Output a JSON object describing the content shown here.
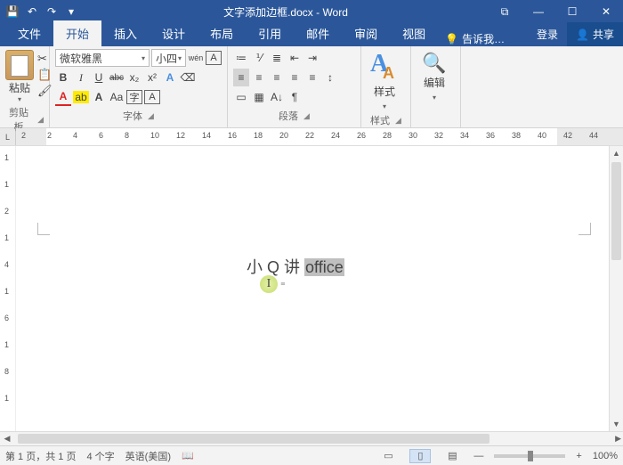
{
  "titlebar": {
    "doc_title": "文字添加边框.docx - Word"
  },
  "window": {
    "snap": "⧉",
    "min": "—",
    "max": "☐",
    "close": "✕"
  },
  "qat": {
    "save": "💾",
    "undo": "↶",
    "redo": "↷",
    "more": "▾"
  },
  "tabs": {
    "file": "文件",
    "home": "开始",
    "insert": "插入",
    "design": "设计",
    "layout": "布局",
    "references": "引用",
    "mail": "邮件",
    "review": "审阅",
    "view": "视图",
    "tell_icon": "💡",
    "tell": "告诉我…",
    "login": "登录",
    "share_icon": "👤",
    "share": "共享"
  },
  "clipboard": {
    "label": "剪贴板",
    "paste": "粘贴",
    "cut": "✂",
    "copy": "📋",
    "painter": "🖌"
  },
  "font": {
    "label": "字体",
    "name": "微软雅黑",
    "size": "小四",
    "wen": "wén",
    "inc": "A",
    "dec": "A",
    "char_box": "A",
    "bold": "B",
    "italic": "I",
    "underline": "U",
    "strike": "abc",
    "sub": "x₂",
    "sup": "x²",
    "effects": "A",
    "highlight": "ab",
    "phonetic": "A",
    "change_case": "Aa",
    "clear": "⌫",
    "circled": "字",
    "border_char": "A"
  },
  "paragraph": {
    "label": "段落",
    "bullets": "≔",
    "numbers": "⅟",
    "multilevel": "≣",
    "dec_indent": "⇤",
    "inc_indent": "⇥",
    "al_left": "≡",
    "al_center": "≡",
    "al_right": "≡",
    "al_just": "≡",
    "al_dist": "≡",
    "linespacing": "↕",
    "sort": "A↓",
    "showmarks": "¶",
    "shading": "▭",
    "borders": "▦"
  },
  "styles": {
    "label": "样式",
    "styles_btn": "样式",
    "icon_top": "A",
    "icon_bottom": "A"
  },
  "editing": {
    "label": "编辑",
    "find": "🔍",
    "btn": "编辑"
  },
  "ruler": {
    "marker": "L",
    "ticks": [
      "2",
      "2",
      "4",
      "6",
      "8",
      "10",
      "12",
      "14",
      "16",
      "18",
      "20",
      "22",
      "24",
      "26",
      "28",
      "30",
      "32",
      "34",
      "36",
      "38",
      "40",
      "42",
      "44"
    ]
  },
  "vruler": {
    "ticks": [
      "1",
      "1",
      "2",
      "1",
      "4",
      "1",
      "6",
      "1",
      "8",
      "1"
    ]
  },
  "document": {
    "text_plain": "小 Q 讲 ",
    "text_selected": "office",
    "cursor_glyph": "I",
    "mini_cursor": "⁼"
  },
  "status": {
    "page": "第 1 页，共 1 页",
    "words": "4 个字",
    "lang": "英语(美国)",
    "view_read": "▭",
    "view_print": "▯",
    "view_web": "▤",
    "zoom_out": "—",
    "zoom_in": "+",
    "zoom_pct": "100%"
  }
}
